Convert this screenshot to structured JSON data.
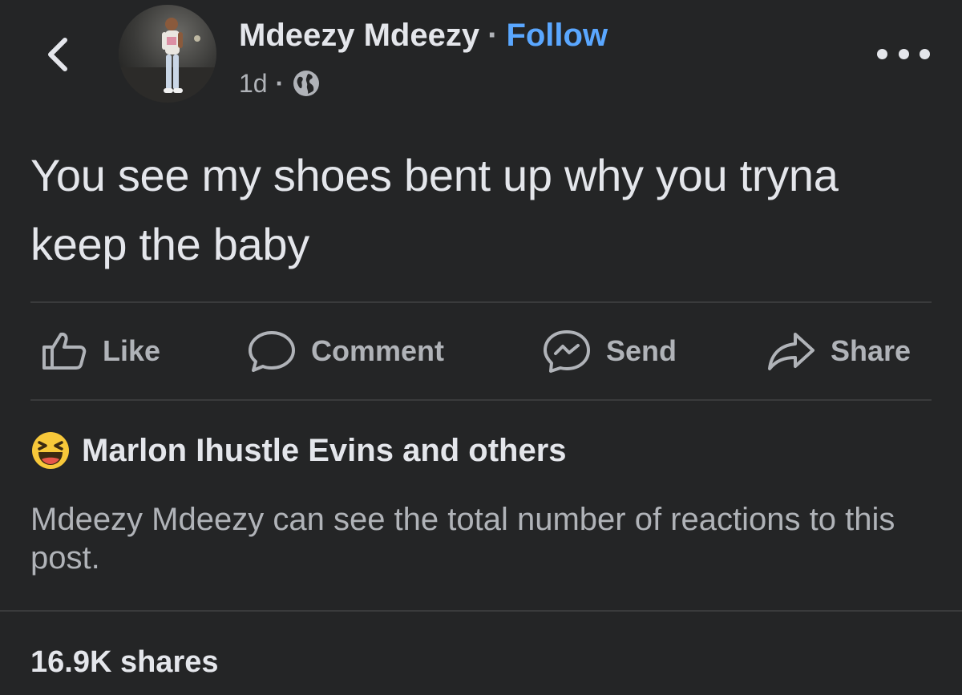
{
  "header": {
    "author_name": "Mdeezy Mdeezy",
    "separator": "·",
    "follow_label": "Follow",
    "timestamp": "1d",
    "audience_icon": "globe-icon"
  },
  "post": {
    "text": "You see my shoes bent up why you tryna keep the baby"
  },
  "actions": {
    "like": {
      "label": "Like",
      "icon": "thumbs-up-icon"
    },
    "comment": {
      "label": "Comment",
      "icon": "comment-bubble-icon"
    },
    "send": {
      "label": "Send",
      "icon": "messenger-icon"
    },
    "share": {
      "label": "Share",
      "icon": "share-arrow-icon"
    }
  },
  "reactions": {
    "emoji_icon": "laughing-emoji-icon",
    "summary": "Marlon Ihustle Evins and others"
  },
  "notice": "Mdeezy Mdeezy can see the total number of reactions to this post.",
  "shares": "16.9K shares",
  "colors": {
    "background": "#242526",
    "primary_text": "#e4e6eb",
    "secondary_text": "#b0b3b8",
    "link": "#5aa7ff",
    "divider": "#3a3b3c",
    "emoji_yellow": "#f7c83a"
  }
}
